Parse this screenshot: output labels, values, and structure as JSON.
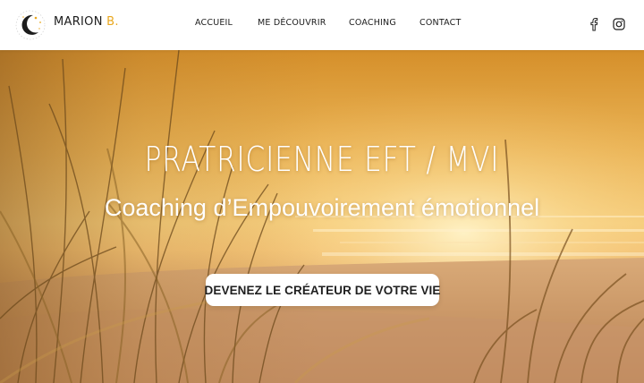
{
  "brand": {
    "name": "MARION",
    "initial": "B."
  },
  "nav": {
    "items": [
      "ACCUEIL",
      "ME DÉCOUVRIR",
      "COACHING",
      "CONTACT"
    ]
  },
  "social": {
    "icons": [
      "facebook-icon",
      "instagram-icon"
    ]
  },
  "hero": {
    "title": "PRATRICIENNE EFT / MVI",
    "subtitle": "Coaching d’Empouvoirement émotionnel",
    "cta_label": "DEVENEZ LE CRÉATEUR DE VOTRE VIE"
  },
  "colors": {
    "accent": "#e9a71e",
    "text": "#1c1c1c",
    "header_bg": "#ffffff"
  }
}
